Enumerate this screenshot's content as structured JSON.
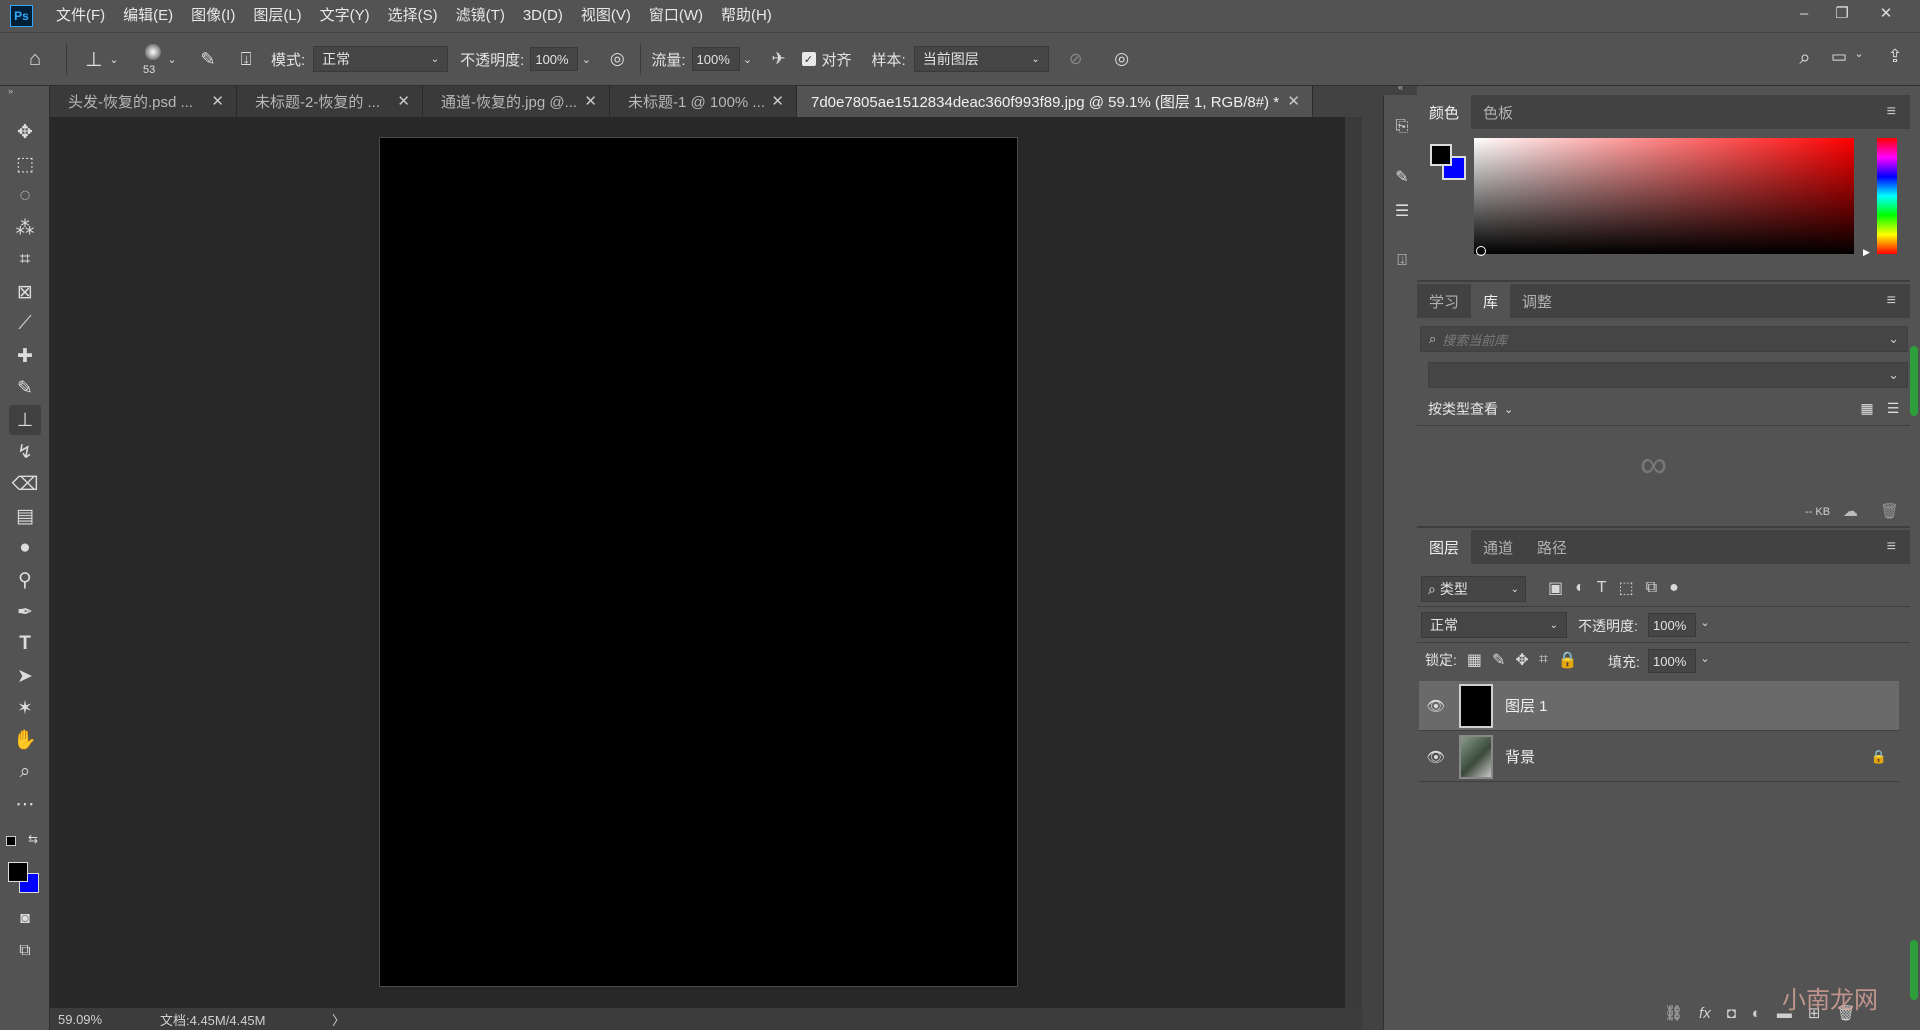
{
  "app": {
    "logo": "Ps"
  },
  "menu": [
    "文件(F)",
    "编辑(E)",
    "图像(I)",
    "图层(L)",
    "文字(Y)",
    "选择(S)",
    "滤镜(T)",
    "3D(D)",
    "视图(V)",
    "窗口(W)",
    "帮助(H)"
  ],
  "window_controls": {
    "minimize": "–",
    "restore": "❐",
    "close": "✕"
  },
  "options": {
    "brush_size": "53",
    "mode_label": "模式:",
    "mode_value": "正常",
    "opacity_label": "不透明度:",
    "opacity_value": "100%",
    "flow_label": "流量:",
    "flow_value": "100%",
    "align_label": "对齐",
    "sample_label": "样本:",
    "sample_value": "当前图层"
  },
  "tabs": [
    {
      "label": "头发-恢复的.psd ...",
      "active": false
    },
    {
      "label": "未标题-2-恢复的 ...",
      "active": false
    },
    {
      "label": "通道-恢复的.jpg @...",
      "active": false
    },
    {
      "label": "未标题-1 @ 100% ...",
      "active": false
    },
    {
      "label": "7d0e7805ae1512834deac360f993f89.jpg  @  59.1% (图层 1, RGB/8#) *",
      "active": true
    }
  ],
  "tab_close": "✕",
  "status": {
    "zoom": "59.09%",
    "doc": "文档:4.45M/4.45M",
    "arrow": "〉"
  },
  "color_panel": {
    "tabs": [
      "颜色",
      "色板"
    ],
    "active": "颜色",
    "fg": "#000000",
    "bg": "#0000ff"
  },
  "library_panel": {
    "tabs": [
      "学习",
      "库",
      "调整"
    ],
    "active": "库",
    "search_placeholder": "搜索当前库",
    "view_by": "按类型查看",
    "size": "-- KB"
  },
  "layers_panel": {
    "tabs": [
      "图层",
      "通道",
      "路径"
    ],
    "active": "图层",
    "filter_kind": "类型",
    "blend_mode": "正常",
    "opacity_label": "不透明度:",
    "opacity_value": "100%",
    "lock_label": "锁定:",
    "fill_label": "填充:",
    "fill_value": "100%",
    "layers": [
      {
        "name": "图层 1",
        "selected": true,
        "locked": false
      },
      {
        "name": "背景",
        "selected": false,
        "locked": true
      }
    ]
  },
  "watermark": "小南龙网"
}
